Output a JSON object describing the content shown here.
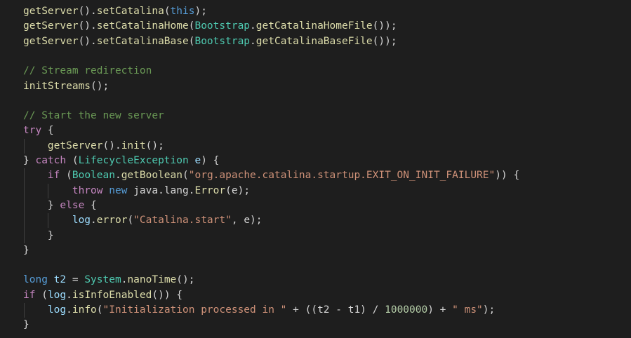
{
  "theme": {
    "background": "#1e1e1e",
    "text": "#d4d4d4",
    "function": "#dcdcaa",
    "keyword": "#569cd6",
    "control": "#c586c0",
    "type": "#4ec9b0",
    "variable": "#9cdcfe",
    "string": "#ce9178",
    "number": "#b5cea8",
    "comment": "#6a9955"
  },
  "code": {
    "lines": [
      [
        [
          "fn",
          "getServer"
        ],
        [
          "p",
          "()."
        ],
        [
          "fn",
          "setCatalina"
        ],
        [
          "p",
          "("
        ],
        [
          "kw",
          "this"
        ],
        [
          "p",
          ");"
        ]
      ],
      [
        [
          "fn",
          "getServer"
        ],
        [
          "p",
          "()."
        ],
        [
          "fn",
          "setCatalinaHome"
        ],
        [
          "p",
          "("
        ],
        [
          "ty",
          "Bootstrap"
        ],
        [
          "p",
          "."
        ],
        [
          "fn",
          "getCatalinaHomeFile"
        ],
        [
          "p",
          "());"
        ]
      ],
      [
        [
          "fn",
          "getServer"
        ],
        [
          "p",
          "()."
        ],
        [
          "fn",
          "setCatalinaBase"
        ],
        [
          "p",
          "("
        ],
        [
          "ty",
          "Bootstrap"
        ],
        [
          "p",
          "."
        ],
        [
          "fn",
          "getCatalinaBaseFile"
        ],
        [
          "p",
          "());"
        ]
      ],
      [],
      [
        [
          "cm",
          "// Stream redirection"
        ]
      ],
      [
        [
          "fn",
          "initStreams"
        ],
        [
          "p",
          "();"
        ]
      ],
      [],
      [
        [
          "cm",
          "// Start the new server"
        ]
      ],
      [
        [
          "ctl",
          "try"
        ],
        [
          "p",
          " {"
        ]
      ],
      [
        [
          "p",
          "    "
        ],
        [
          "fn",
          "getServer"
        ],
        [
          "p",
          "()."
        ],
        [
          "fn",
          "init"
        ],
        [
          "p",
          "();"
        ]
      ],
      [
        [
          "p",
          "} "
        ],
        [
          "ctl",
          "catch"
        ],
        [
          "p",
          " ("
        ],
        [
          "ty",
          "LifecycleException"
        ],
        [
          "p",
          " "
        ],
        [
          "var",
          "e"
        ],
        [
          "p",
          ") {"
        ]
      ],
      [
        [
          "p",
          "    "
        ],
        [
          "ctl",
          "if"
        ],
        [
          "p",
          " ("
        ],
        [
          "ty",
          "Boolean"
        ],
        [
          "p",
          "."
        ],
        [
          "fn",
          "getBoolean"
        ],
        [
          "p",
          "("
        ],
        [
          "str",
          "\"org.apache.catalina.startup.EXIT_ON_INIT_FAILURE\""
        ],
        [
          "p",
          ")) {"
        ]
      ],
      [
        [
          "p",
          "        "
        ],
        [
          "ctl",
          "throw"
        ],
        [
          "p",
          " "
        ],
        [
          "kw",
          "new"
        ],
        [
          "p",
          " java.lang."
        ],
        [
          "fn",
          "Error"
        ],
        [
          "p",
          "(e);"
        ]
      ],
      [
        [
          "p",
          "    } "
        ],
        [
          "ctl",
          "else"
        ],
        [
          "p",
          " {"
        ]
      ],
      [
        [
          "p",
          "        "
        ],
        [
          "var",
          "log"
        ],
        [
          "p",
          "."
        ],
        [
          "fn",
          "error"
        ],
        [
          "p",
          "("
        ],
        [
          "str",
          "\"Catalina.start\""
        ],
        [
          "p",
          ", e);"
        ]
      ],
      [
        [
          "p",
          "    }"
        ]
      ],
      [
        [
          "p",
          "}"
        ]
      ],
      [],
      [
        [
          "kw",
          "long"
        ],
        [
          "p",
          " "
        ],
        [
          "var",
          "t2"
        ],
        [
          "p",
          " = "
        ],
        [
          "ty",
          "System"
        ],
        [
          "p",
          "."
        ],
        [
          "fn",
          "nanoTime"
        ],
        [
          "p",
          "();"
        ]
      ],
      [
        [
          "ctl",
          "if"
        ],
        [
          "p",
          " ("
        ],
        [
          "var",
          "log"
        ],
        [
          "p",
          "."
        ],
        [
          "fn",
          "isInfoEnabled"
        ],
        [
          "p",
          "()) {"
        ]
      ],
      [
        [
          "p",
          "    "
        ],
        [
          "var",
          "log"
        ],
        [
          "p",
          "."
        ],
        [
          "fn",
          "info"
        ],
        [
          "p",
          "("
        ],
        [
          "str",
          "\"Initialization processed in \""
        ],
        [
          "p",
          " + ((t2 - t1) / "
        ],
        [
          "num",
          "1000000"
        ],
        [
          "p",
          ") + "
        ],
        [
          "str",
          "\" ms\""
        ],
        [
          "p",
          ");"
        ]
      ],
      [
        [
          "p",
          "}"
        ]
      ]
    ]
  }
}
